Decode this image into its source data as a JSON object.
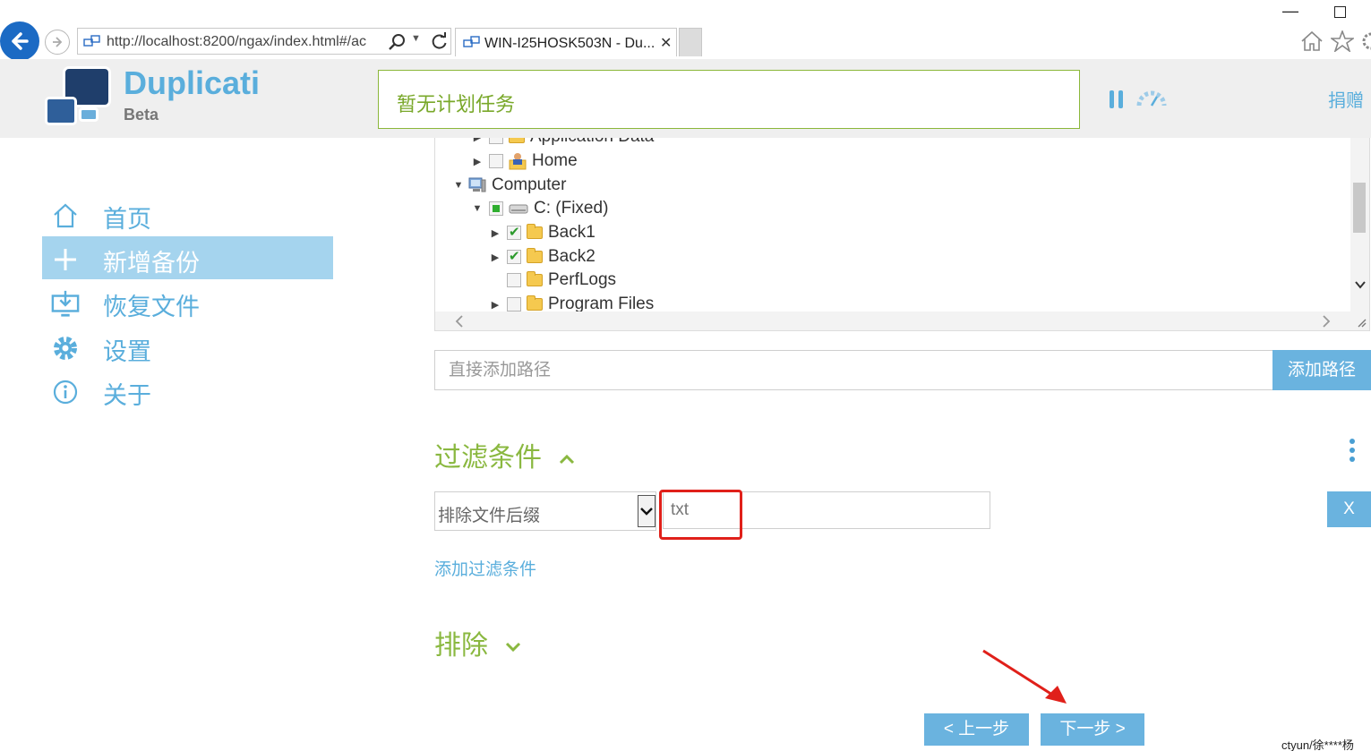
{
  "browser": {
    "url": "http://localhost:8200/ngax/index.html#/ac",
    "tab_title": "WIN-I25HOSK503N - Du...",
    "tab_close": "✕"
  },
  "app": {
    "brand": "Duplicati",
    "sub": "Beta",
    "status": "暂无计划任务",
    "donate": "捐赠"
  },
  "sidebar": {
    "items": [
      {
        "label": "首页",
        "icon": "home-icon"
      },
      {
        "label": "新增备份",
        "icon": "plus-icon"
      },
      {
        "label": "恢复文件",
        "icon": "restore-icon"
      },
      {
        "label": "设置",
        "icon": "gear-icon"
      },
      {
        "label": "关于",
        "icon": "info-icon"
      }
    ]
  },
  "tree": {
    "nodes": [
      {
        "label": "Application Data",
        "state": "unchecked",
        "expanded": false
      },
      {
        "label": "Home",
        "state": "unchecked",
        "expanded": false
      },
      {
        "label": "Computer",
        "expanded": true
      },
      {
        "label": "C: (Fixed)",
        "state": "partial",
        "expanded": true
      },
      {
        "label": "Back1",
        "state": "checked",
        "expanded": false
      },
      {
        "label": "Back2",
        "state": "checked",
        "expanded": false
      },
      {
        "label": "PerfLogs",
        "state": "unchecked"
      },
      {
        "label": "Program Files",
        "state": "unchecked",
        "expanded": false
      }
    ]
  },
  "add_path": {
    "placeholder": "直接添加路径",
    "button": "添加路径"
  },
  "filters": {
    "title": "过滤条件",
    "type": "排除文件后缀",
    "value": "txt",
    "remove": "X",
    "add": "添加过滤条件"
  },
  "exclude": {
    "title": "排除"
  },
  "wizard": {
    "prev": "< 上一步",
    "next": "下一步 >"
  },
  "watermark": "ctyun/徐****杨",
  "colors": {
    "accent": "#5aaedc",
    "green": "#8ab840",
    "active_bg": "#a5d4ee",
    "highlight": "#e0201a"
  }
}
